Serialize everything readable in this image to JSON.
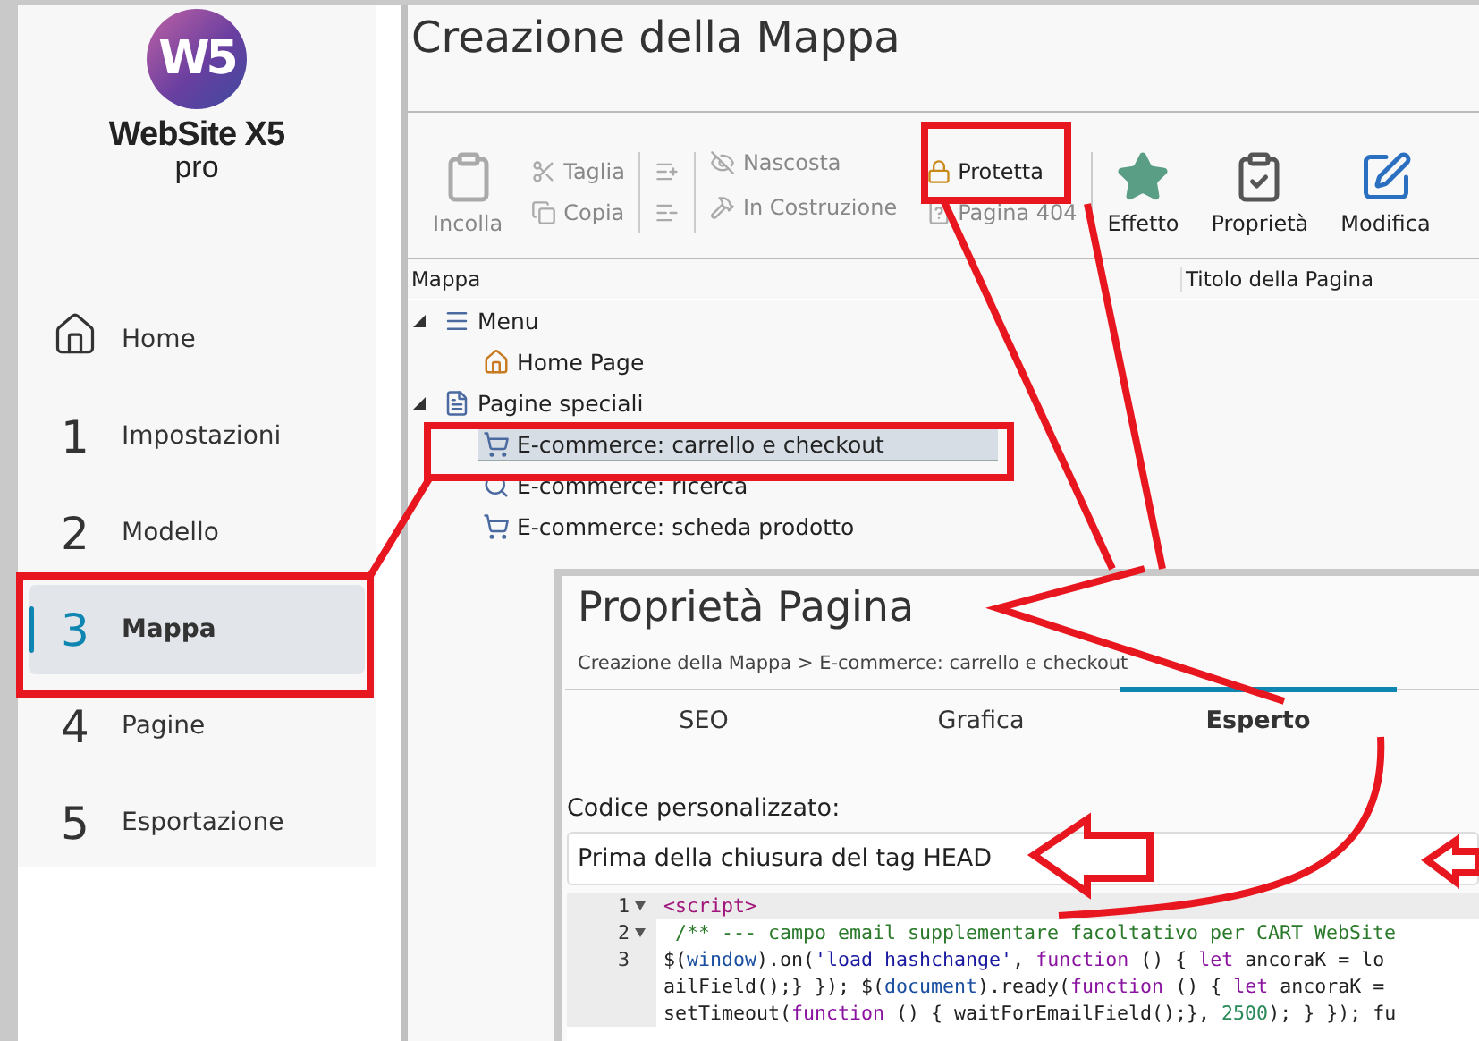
{
  "logo": {
    "mark": "W5",
    "name": "WebSite X5",
    "edition": "pro"
  },
  "sidebar": {
    "items": [
      {
        "kind": "home",
        "label": "Home",
        "selected": false
      },
      {
        "kind": "step",
        "glyph": "1",
        "label": "Impostazioni",
        "selected": false
      },
      {
        "kind": "step",
        "glyph": "2",
        "label": "Modello",
        "selected": false
      },
      {
        "kind": "step",
        "glyph": "3",
        "label": "Mappa",
        "selected": true
      },
      {
        "kind": "step",
        "glyph": "4",
        "label": "Pagine",
        "selected": false
      },
      {
        "kind": "step",
        "glyph": "5",
        "label": "Esportazione",
        "selected": false
      }
    ]
  },
  "page_title": "Creazione della Mappa",
  "toolbar": {
    "groups": [
      {
        "kind": "large",
        "items": [
          {
            "label": "Incolla",
            "disabled": true
          }
        ]
      },
      {
        "kind": "small",
        "items": [
          {
            "label": "Taglia",
            "disabled": true
          },
          {
            "label": "Copia",
            "disabled": true
          }
        ]
      },
      {
        "kind": "icons",
        "items": [
          {
            "disabled": true
          },
          {
            "disabled": true
          }
        ]
      },
      {
        "kind": "small",
        "items": [
          {
            "label": "Nascosta",
            "disabled": true
          },
          {
            "label": "In Costruzione",
            "disabled": true
          }
        ]
      },
      {
        "kind": "small",
        "items": [
          {
            "label": "Protetta",
            "disabled": false
          },
          {
            "label": "Pagina 404",
            "disabled": true
          }
        ]
      },
      {
        "kind": "large",
        "items": [
          {
            "label": "Effetto",
            "disabled": false
          },
          {
            "label": "Proprietà",
            "disabled": false
          },
          {
            "label": "Modifica",
            "disabled": false
          }
        ]
      }
    ]
  },
  "tree": {
    "columns": [
      "Mappa",
      "Titolo della Pagina"
    ],
    "nodes": [
      {
        "kind": "menu",
        "label": "Menu",
        "expanded": true,
        "selected": false,
        "children": [
          {
            "kind": "home",
            "label": "Home Page",
            "selected": false
          }
        ]
      },
      {
        "kind": "folder",
        "label": "Pagine speciali",
        "expanded": true,
        "selected": false,
        "children": [
          {
            "kind": "cart",
            "label": "E-commerce: carrello e checkout",
            "selected": true
          },
          {
            "kind": "search",
            "label": "E-commerce: ricerca",
            "selected": false
          },
          {
            "kind": "cart",
            "label": "E-commerce: scheda prodotto",
            "selected": false
          }
        ]
      }
    ]
  },
  "properties_panel": {
    "title": "Proprietà Pagina",
    "breadcrumb": "Creazione della Mappa > E-commerce: carrello e checkout",
    "tabs": [
      {
        "label": "SEO",
        "selected": false
      },
      {
        "label": "Grafica",
        "selected": false
      },
      {
        "label": "Esperto",
        "selected": true
      }
    ],
    "field_label": "Codice personalizzato:",
    "position_select": {
      "value": "Prima della chiusura del tag HEAD"
    },
    "code_lines": [
      {
        "number": "1",
        "fold": true,
        "active": true,
        "tokens": [
          {
            "kind": "tag",
            "text": "<script>"
          }
        ]
      },
      {
        "number": "2",
        "fold": true,
        "active": false,
        "tokens": [
          {
            "kind": "comment",
            "text": " /** --- campo email supplementare facoltativo per CART WebSite"
          }
        ]
      },
      {
        "number": "3",
        "fold": false,
        "active": false,
        "tokens": [
          {
            "kind": "plain",
            "text": "$("
          },
          {
            "kind": "variable",
            "text": "window"
          },
          {
            "kind": "plain",
            "text": ").on("
          },
          {
            "kind": "string",
            "text": "'load hashchange'"
          },
          {
            "kind": "plain",
            "text": ", "
          },
          {
            "kind": "keyword",
            "text": "function"
          },
          {
            "kind": "plain",
            "text": " () { "
          },
          {
            "kind": "keyword",
            "text": "let"
          },
          {
            "kind": "plain",
            "text": " ancoraK = lo"
          }
        ]
      },
      {
        "fold": false,
        "active": false,
        "tokens": [
          {
            "kind": "plain",
            "text": "ailField();} }); $("
          },
          {
            "kind": "variable",
            "text": "document"
          },
          {
            "kind": "plain",
            "text": ").ready("
          },
          {
            "kind": "keyword",
            "text": "function"
          },
          {
            "kind": "plain",
            "text": " () { "
          },
          {
            "kind": "keyword",
            "text": "let"
          },
          {
            "kind": "plain",
            "text": " ancoraK ="
          }
        ]
      },
      {
        "fold": false,
        "active": false,
        "tokens": [
          {
            "kind": "plain",
            "text": "setTimeout("
          },
          {
            "kind": "keyword",
            "text": "function"
          },
          {
            "kind": "plain",
            "text": " () { waitForEmailField();}, "
          },
          {
            "kind": "number",
            "text": "2500"
          },
          {
            "kind": "plain",
            "text": "); } }); fu"
          }
        ]
      }
    ]
  }
}
